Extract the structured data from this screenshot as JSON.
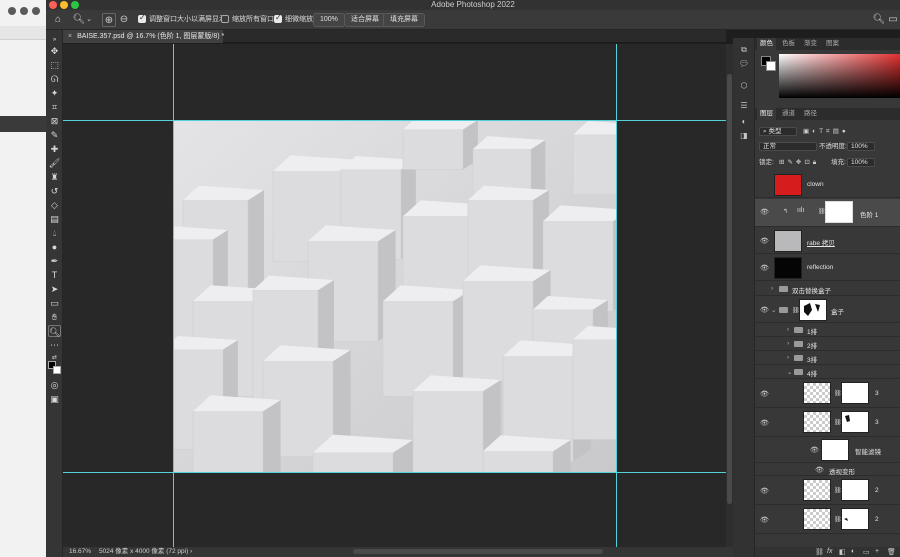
{
  "window": {
    "title": "Adobe Photoshop 2022"
  },
  "options_bar": {
    "checkbox1_label": "调整窗口大小以满屏显示",
    "checkbox2_label": "缩放所有窗口",
    "checkbox3_label": "细微缩放",
    "zoom_value": "100%",
    "fit_screen_label": "适合屏幕",
    "fill_screen_label": "填充屏幕"
  },
  "document_tab": {
    "close": "×",
    "label": "BAISE.357.psd @ 16.7% (色阶 1, 图层蒙版/8) *"
  },
  "status_bar": {
    "zoom": "16.67%",
    "info": "5024 像素 x 4000 像素 (72 ppi)",
    "arrow": "›"
  },
  "color_panel": {
    "tabs": [
      "颜色",
      "色板",
      "渐变",
      "图案"
    ],
    "foreground": "#000000",
    "background": "#ffffff"
  },
  "layers_panel": {
    "tabs": [
      "图层",
      "通道",
      "路径"
    ],
    "filter_kind": "类型",
    "blend_mode": "正常",
    "opacity_label": "不透明度:",
    "opacity_value": "100%",
    "lock_label": "锁定:",
    "fill_label": "填充:",
    "fill_value": "100%",
    "layers": [
      {
        "name": "clown"
      },
      {
        "name": "色阶 1"
      },
      {
        "name": "rabe 拷贝"
      },
      {
        "name": "reflection"
      },
      {
        "name": "双击替换盒子"
      },
      {
        "name": "盒子"
      },
      {
        "name": "1排"
      },
      {
        "name": "2排"
      },
      {
        "name": "3排"
      },
      {
        "name": "4排"
      },
      {
        "name": "3"
      },
      {
        "name": "3"
      },
      {
        "name": "智能滤镜"
      },
      {
        "name": "透视变形"
      },
      {
        "name": "2"
      },
      {
        "name": "2"
      }
    ],
    "bottom_icons": [
      "⛓",
      "fx",
      "◧",
      "◐",
      "▭",
      "+",
      "🗑"
    ]
  },
  "colors": {
    "guide": "#55d0d8",
    "accent_red": "#e23030"
  }
}
